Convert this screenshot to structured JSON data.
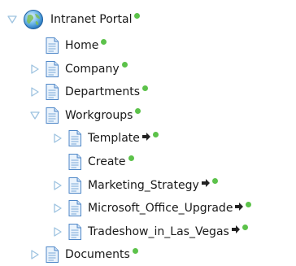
{
  "tree": {
    "root": {
      "label": "Intranet Portal",
      "icon": "globe-icon",
      "expanded": true
    },
    "items": [
      {
        "label": "Home",
        "level": 1,
        "toggle": "none"
      },
      {
        "label": "Company",
        "level": 1,
        "toggle": "collapsed"
      },
      {
        "label": "Departments",
        "level": 1,
        "toggle": "collapsed"
      },
      {
        "label": "Workgroups",
        "level": 1,
        "toggle": "expanded"
      },
      {
        "label": "Template",
        "level": 2,
        "toggle": "collapsed",
        "arrow": true
      },
      {
        "label": "Create",
        "level": 2,
        "toggle": "none"
      },
      {
        "label": "Marketing_Strategy",
        "level": 2,
        "toggle": "collapsed",
        "arrow": true
      },
      {
        "label": "Microsoft_Office_Upgrade",
        "level": 2,
        "toggle": "collapsed",
        "arrow": true
      },
      {
        "label": "Tradeshow_in_Las_Vegas",
        "level": 2,
        "toggle": "collapsed",
        "arrow": true
      },
      {
        "label": "Documents",
        "level": 1,
        "toggle": "collapsed"
      }
    ]
  },
  "colors": {
    "status_dot": "#5cc24a",
    "toggle": "#9ec3e0",
    "page_blue": "#4d86c7"
  }
}
